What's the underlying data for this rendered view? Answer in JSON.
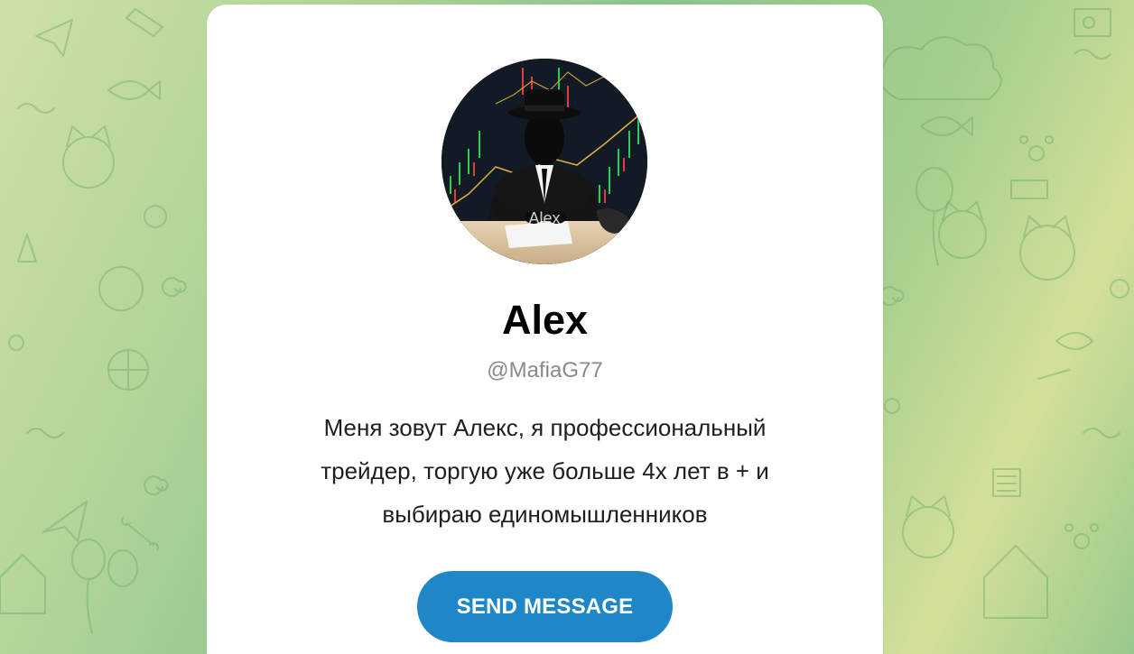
{
  "colors": {
    "background_start": "#cfe0a6",
    "background_mid": "#8cc48c",
    "card": "#ffffff",
    "button": "#1f86c8",
    "button_text": "#ffffff",
    "handle_text": "#8a8a8a"
  },
  "profile": {
    "avatar_watermark": "Alex",
    "name": "Alex",
    "handle": "@MafiaG77",
    "bio_lines": [
      "Меня зовут Алекс, я профессиональный",
      "трейдер, торгую уже больше 4х лет в + и",
      "выбираю единомышленников"
    ]
  },
  "actions": {
    "send_message_label": "SEND MESSAGE"
  },
  "background": {
    "pattern_icons": [
      "paper-plane-icon",
      "fish-icon",
      "cat-icon",
      "balloon-icon",
      "paw-icon",
      "bone-icon",
      "ball-icon",
      "doghouse-icon"
    ]
  }
}
